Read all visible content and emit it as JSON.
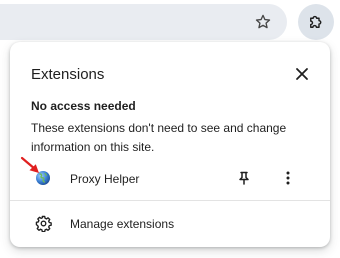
{
  "toolbar": {
    "bookmark_icon": "star-outline-icon",
    "extensions_icon": "puzzle-piece-icon"
  },
  "popup": {
    "title": "Extensions",
    "close_icon": "close-icon",
    "section": {
      "heading": "No access needed",
      "description": "These extensions don't need to see and change information on this site."
    },
    "extensions": [
      {
        "name": "Proxy Helper",
        "icon": "globe-icon",
        "pin_icon": "pin-icon",
        "more_icon": "more-vertical-icon"
      }
    ],
    "manage": {
      "label": "Manage extensions",
      "icon": "gear-icon"
    }
  },
  "colors": {
    "omnibox_bg": "#e9ecf1",
    "active_button_bg": "#dde3ea",
    "annotation_arrow": "#e02020"
  }
}
